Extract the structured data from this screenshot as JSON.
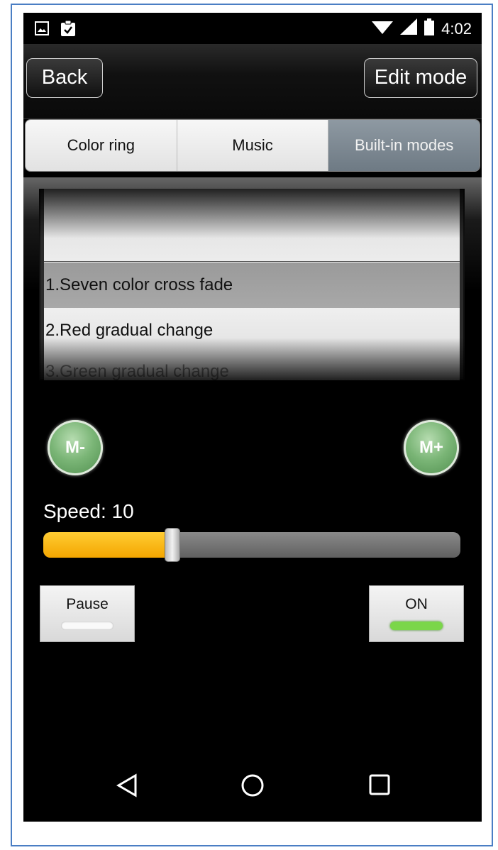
{
  "status_bar": {
    "time": "4:02",
    "icons": [
      "image-notification-icon",
      "clipboard-check-icon",
      "wifi-icon",
      "cell-signal-icon",
      "battery-icon"
    ]
  },
  "action_bar": {
    "back_label": "Back",
    "edit_label": "Edit mode"
  },
  "tabs": [
    {
      "label": "Color ring",
      "active": false
    },
    {
      "label": "Music",
      "active": false
    },
    {
      "label": "Built-in modes",
      "active": true
    }
  ],
  "mode_picker": {
    "items": [
      "1.Seven color cross fade",
      "2.Red gradual change",
      "3.Green gradual change"
    ],
    "selected_index": 0
  },
  "mode_buttons": {
    "prev_label": "M-",
    "next_label": "M+"
  },
  "speed": {
    "label": "Speed: 10",
    "value": 10,
    "fill_fraction": 0.31
  },
  "controls": {
    "pause_label": "Pause",
    "on_label": "ON",
    "pause_led_color": "#f9f9f9",
    "on_led_color": "#7bd64a"
  },
  "nav_bar": {
    "icons": [
      "back-triangle-icon",
      "home-circle-icon",
      "recents-square-icon"
    ]
  },
  "colors": {
    "frame_border": "#4a7ec4",
    "active_tab": "#7e8992",
    "slider_fill": "#f4b400"
  }
}
